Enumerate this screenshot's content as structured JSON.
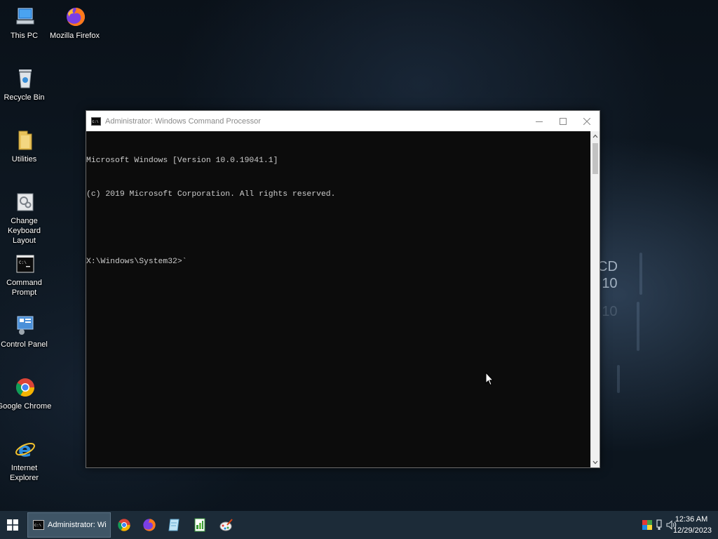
{
  "desktop": {
    "icons": [
      {
        "label": "This PC",
        "icon": "this-pc-icon"
      },
      {
        "label": "Mozilla Firefox",
        "icon": "firefox-icon"
      },
      {
        "label": "Recycle Bin",
        "icon": "recycle-bin-icon"
      },
      {
        "label": "Utilities",
        "icon": "folder-icon"
      },
      {
        "label": "Change Keyboard Layout",
        "icon": "keyboard-layout-icon"
      },
      {
        "label": "Command Prompt",
        "icon": "command-prompt-icon"
      },
      {
        "label": "Control Panel",
        "icon": "control-panel-icon"
      },
      {
        "label": "Google Chrome",
        "icon": "chrome-icon"
      },
      {
        "label": "Internet Explorer",
        "icon": "internet-explorer-icon"
      }
    ],
    "wallpaper_text": {
      "line1": "CD",
      "line2": "10",
      "line3": "10"
    }
  },
  "window": {
    "title": "Administrator: Windows Command Processor",
    "console_lines": [
      "Microsoft Windows [Version 10.0.19041.1]",
      "(c) 2019 Microsoft Corporation. All rights reserved.",
      "",
      "X:\\Windows\\System32>`"
    ]
  },
  "taskbar": {
    "active_task_label": "Administrator: Win...",
    "pinned": [
      "chrome-icon",
      "firefox-icon",
      "notepad-icon",
      "spreadsheet-icon",
      "paint-icon"
    ],
    "clock": {
      "time": "12:36 AM",
      "date": "12/29/2023"
    }
  },
  "colors": {
    "console_bg": "#0c0c0c",
    "console_text": "#cccccc",
    "taskbar_bg": "#1c2b38",
    "taskbar_active": "#3f5566"
  }
}
